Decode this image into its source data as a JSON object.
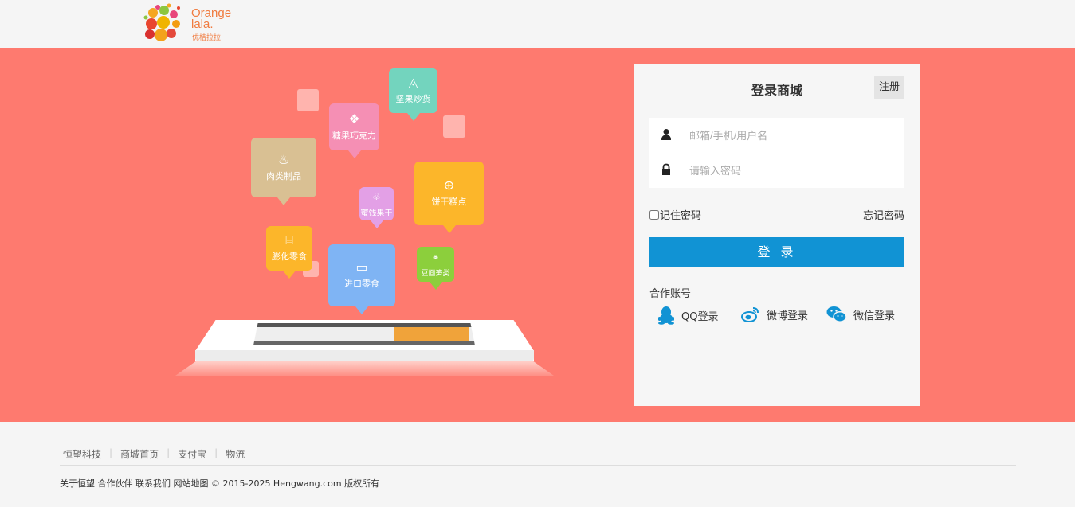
{
  "brand": {
    "name_line1": "Orange",
    "name_line2": "lala.",
    "tagline": "优桔拉拉"
  },
  "colors": {
    "banner": "#fe7a6f",
    "primary": "#1193d4",
    "logo": "#f07b3f"
  },
  "categories": [
    {
      "label": "坚果炒货",
      "icon": "nut-icon",
      "color": "#73d4be"
    },
    {
      "label": "糖果巧克力",
      "icon": "candy-icon",
      "color": "#f58fb4"
    },
    {
      "label": "肉类制品",
      "icon": "meat-icon",
      "color": "#d9c093"
    },
    {
      "label": "蜜饯果干",
      "icon": "cherry-icon",
      "color": "#e3a0e6"
    },
    {
      "label": "饼干糕点",
      "icon": "biscuit-icon",
      "color": "#fcb62a"
    },
    {
      "label": "膨化零食",
      "icon": "chips-icon",
      "color": "#fcb62a"
    },
    {
      "label": "进口零食",
      "icon": "import-icon",
      "color": "#7fb4f4"
    },
    {
      "label": "豆面笋类",
      "icon": "skewer-icon",
      "color": "#8ccf3c"
    }
  ],
  "login": {
    "title": "登录商城",
    "register": "注册",
    "username_placeholder": "邮箱/手机/用户名",
    "password_placeholder": "请输入密码",
    "remember": "记住密码",
    "forgot": "忘记密码",
    "submit": "登 录",
    "partner_label": "合作账号",
    "social": [
      {
        "label": "QQ登录",
        "icon": "qq-icon"
      },
      {
        "label": "微博登录",
        "icon": "weibo-icon"
      },
      {
        "label": "微信登录",
        "icon": "wechat-icon"
      }
    ]
  },
  "footer": {
    "links": [
      "恒望科技",
      "商城首页",
      "支付宝",
      "物流"
    ],
    "copyright": "关于恒望 合作伙伴 联系我们 网站地图 © 2015-2025 Hengwang.com 版权所有"
  }
}
